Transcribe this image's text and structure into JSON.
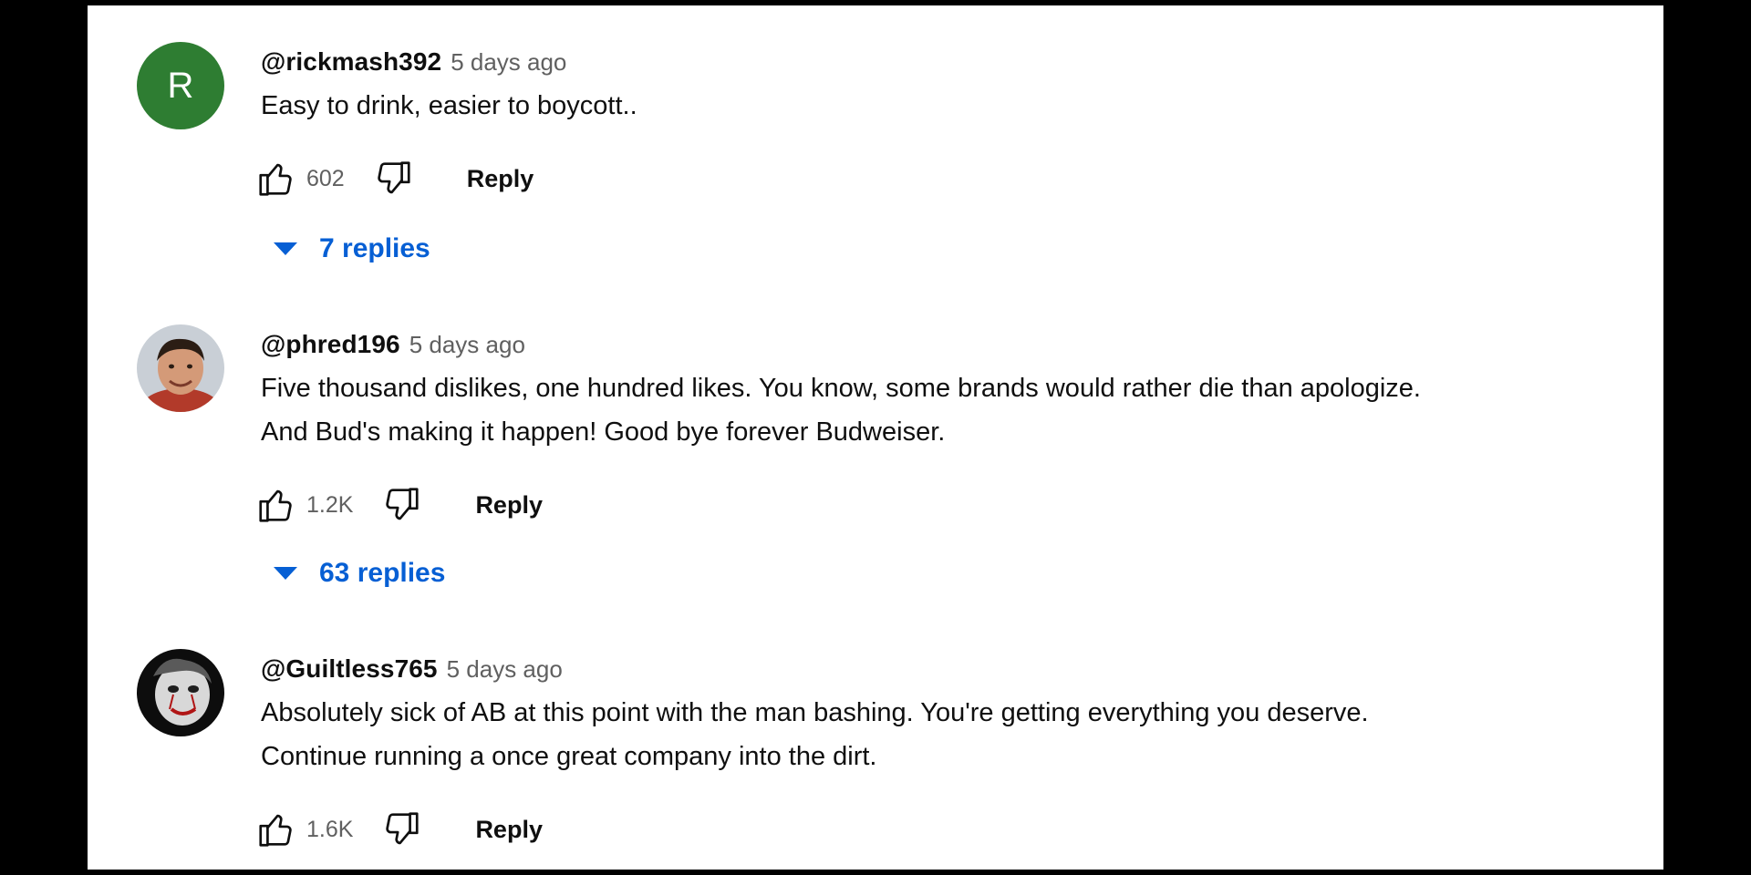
{
  "colors": {
    "frame": "#000000",
    "panel": "#ffffff",
    "text": "#0f0f0f",
    "secondary_text": "#606060",
    "link": "#065fd4",
    "avatar_green": "#2e7d32"
  },
  "icons": {
    "like": "thumbs-up-outline",
    "dislike": "thumbs-down-outline",
    "expand": "caret-down"
  },
  "comments": [
    {
      "avatar_letter": "R",
      "author": "@rickmash392",
      "time": "5 days ago",
      "lines": [
        "Easy to drink, easier to boycott.."
      ],
      "likes": "602",
      "reply_label": "Reply",
      "replies_label": "7 replies"
    },
    {
      "author": "@phred196",
      "time": "5 days ago",
      "lines": [
        "Five thousand dislikes, one hundred likes.  You know, some brands would rather die than apologize.",
        "And Bud's making it happen!  Good bye forever Budweiser."
      ],
      "likes": "1.2K",
      "reply_label": "Reply",
      "replies_label": "63 replies"
    },
    {
      "author": "@Guiltless765",
      "time": "5 days ago",
      "lines": [
        "Absolutely sick of AB at this point with the man bashing. You're getting everything you deserve.",
        "Continue running a once great company into the dirt."
      ],
      "likes": "1.6K",
      "reply_label": "Reply"
    }
  ]
}
